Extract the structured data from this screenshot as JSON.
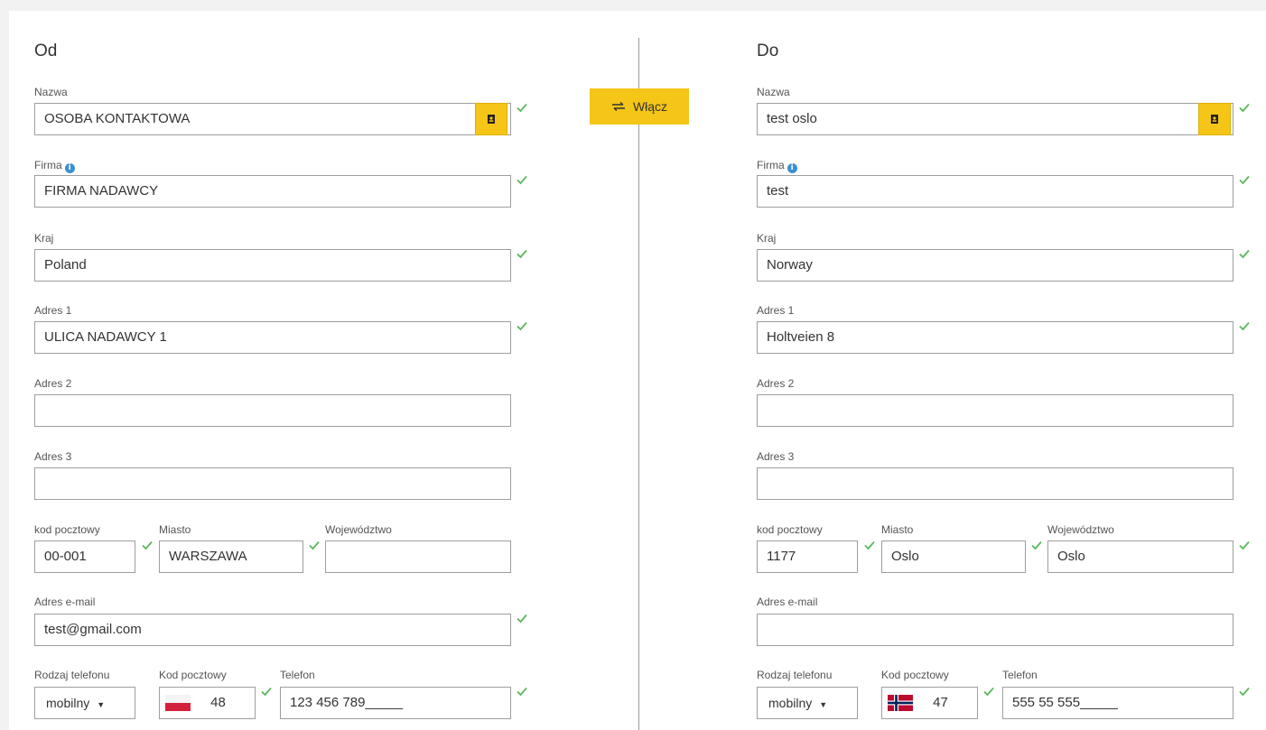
{
  "from": {
    "title": "Od",
    "name": {
      "label": "Nazwa",
      "value": "OSOBA KONTAKTOWA"
    },
    "company": {
      "label": "Firma",
      "value": "FIRMA NADAWCY"
    },
    "country": {
      "label": "Kraj",
      "value": "Poland"
    },
    "address1": {
      "label": "Adres 1",
      "value": "ULICA NADAWCY 1"
    },
    "address2": {
      "label": "Adres 2",
      "value": ""
    },
    "address3": {
      "label": "Adres 3",
      "value": ""
    },
    "postcode": {
      "label": "kod pocztowy",
      "value": "00-001"
    },
    "city": {
      "label": "Miasto",
      "value": "WARSZAWA"
    },
    "province": {
      "label": "Województwo",
      "value": ""
    },
    "email": {
      "label": "Adres e-mail",
      "value": "test@gmail.com"
    },
    "phone_type": {
      "label": "Rodzaj telefonu",
      "value": "mobilny"
    },
    "dial_code": {
      "label": "Kod pocztowy",
      "value": "48",
      "flag": "poland-flag"
    },
    "phone": {
      "label": "Telefon",
      "value": "123 456 789_____"
    }
  },
  "to": {
    "title": "Do",
    "name": {
      "label": "Nazwa",
      "value": "test oslo"
    },
    "company": {
      "label": "Firma",
      "value": "test"
    },
    "country": {
      "label": "Kraj",
      "value": "Norway"
    },
    "address1": {
      "label": "Adres 1",
      "value": "Holtveien 8"
    },
    "address2": {
      "label": "Adres 2",
      "value": ""
    },
    "address3": {
      "label": "Adres 3",
      "value": ""
    },
    "postcode": {
      "label": "kod pocztowy",
      "value": "1177"
    },
    "city": {
      "label": "Miasto",
      "value": "Oslo"
    },
    "province": {
      "label": "Województwo",
      "value": "Oslo"
    },
    "email": {
      "label": "Adres e-mail",
      "value": ""
    },
    "phone_type": {
      "label": "Rodzaj telefonu",
      "value": "mobilny"
    },
    "dial_code": {
      "label": "Kod pocztowy",
      "value": "47",
      "flag": "norway-flag"
    },
    "phone": {
      "label": "Telefon",
      "value": "555 55 555_____"
    }
  },
  "merge_button": {
    "label": "Włącz",
    "icon": "swap-arrows-icon"
  },
  "icons": {
    "check": "check-icon",
    "info": "info-icon",
    "address_book": "address-book-icon"
  },
  "colors": {
    "accent": "#f5c518",
    "check": "#5cb85c",
    "info": "#3b8fd4"
  }
}
